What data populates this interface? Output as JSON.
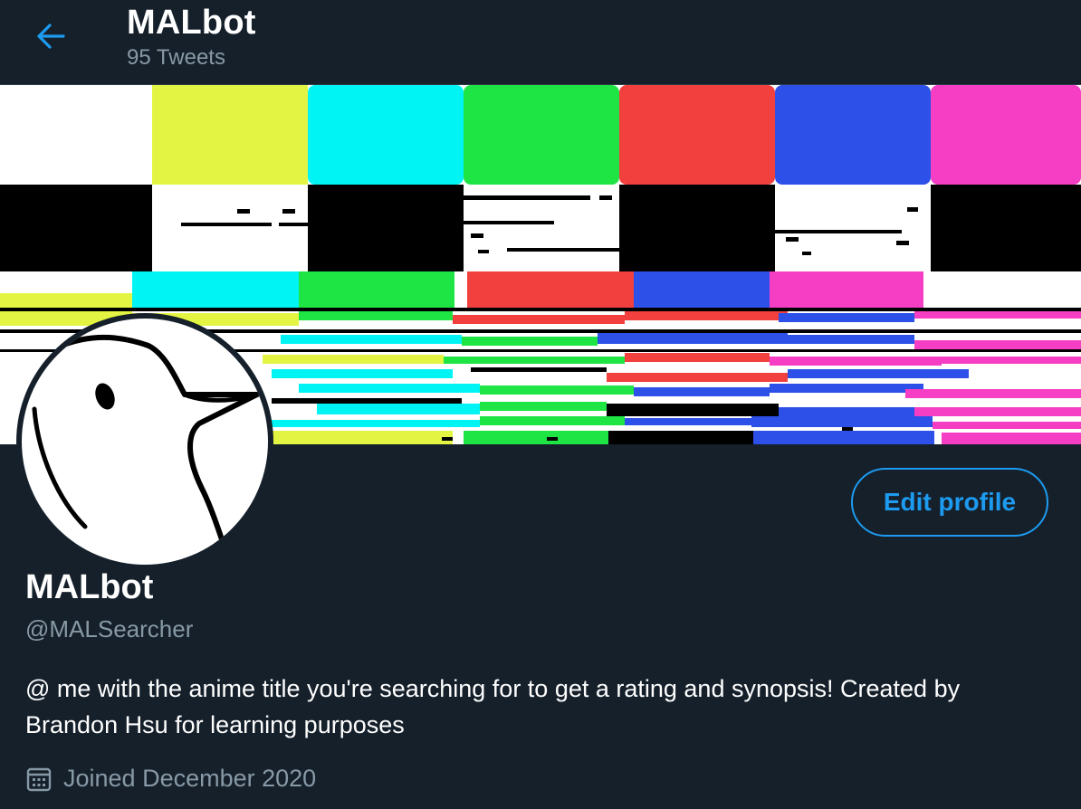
{
  "header": {
    "title": "MALbot",
    "tweet_count": "95 Tweets"
  },
  "profile": {
    "display_name": "MALbot",
    "handle": "@MALSearcher",
    "bio": "@ me with the anime title you're searching for to get a rating and synopsis! Created by Brandon Hsu for learning purposes",
    "joined": "Joined December 2020",
    "edit_button": "Edit profile"
  },
  "icons": {
    "back": "arrow-left-icon",
    "calendar": "calendar-icon"
  },
  "colors": {
    "background": "#15202b",
    "accent": "#1d9bf0",
    "secondary_text": "#8899a6"
  }
}
